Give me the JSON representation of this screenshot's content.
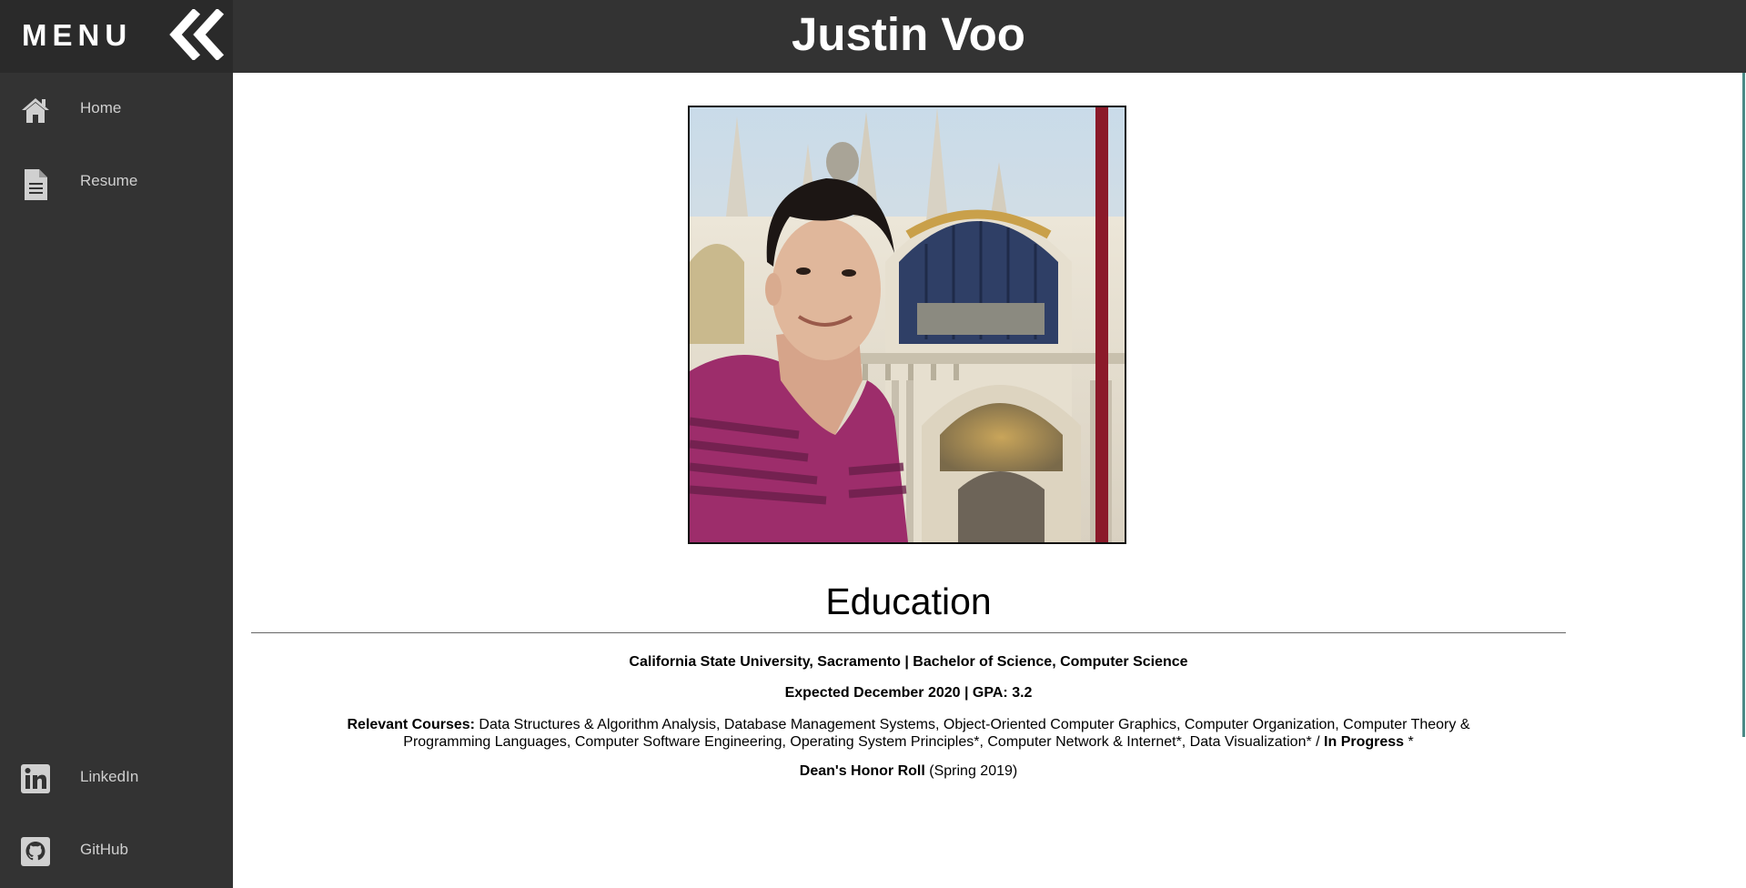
{
  "sidebar": {
    "menu_title": "MENU",
    "collapse_icon": "double-chevron-left-icon",
    "items": [
      {
        "label": "Home",
        "icon": "home-icon"
      },
      {
        "label": "Resume",
        "icon": "document-icon"
      },
      {
        "label": "LinkedIn",
        "icon": "linkedin-icon"
      },
      {
        "label": "GitHub",
        "icon": "github-icon"
      }
    ]
  },
  "header": {
    "title": "Justin Voo"
  },
  "profile": {
    "photo": "profile-photo"
  },
  "education": {
    "heading": "Education",
    "school_line": "California State University, Sacramento | Bachelor of Science, Computer Science",
    "expected_line": "Expected December 2020 | GPA: 3.2",
    "courses_label": "Relevant Courses:",
    "courses_text": " Data Structures & Algorithm Analysis, Database Management Systems, Object-Oriented Computer Graphics, Computer Organization, Computer Theory & Programming Languages, Computer Software Engineering, Operating System Principles*, Computer Network & Internet*, Data Visualization* / ",
    "in_progress_label": "In Progress",
    "in_progress_mark": " *",
    "honor_label": "Dean's Honor Roll",
    "honor_term": " (Spring 2019)"
  },
  "colors": {
    "sidebar_bg": "#333333",
    "sidebar_head_bg": "#2a2a2a",
    "topbar_bg": "#333333",
    "nav_text": "#cfcfcf",
    "accent_scroll": "#4a8a86"
  }
}
